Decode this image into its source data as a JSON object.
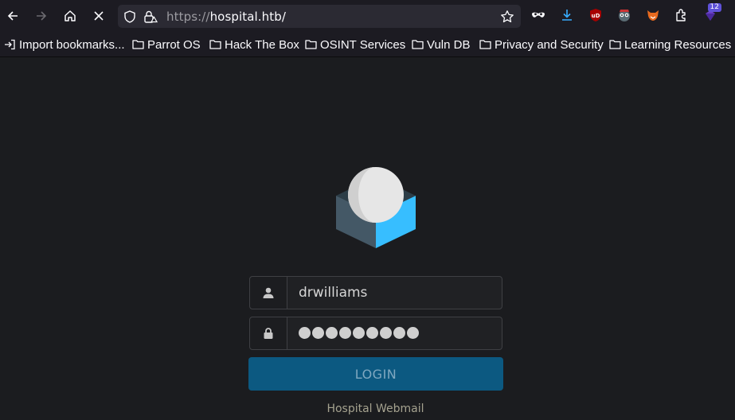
{
  "browser": {
    "url_scheme": "https://",
    "url_host": "hospital.htb/",
    "extension_badge": "12"
  },
  "bookmarks": [
    {
      "label": "Import bookmarks..."
    },
    {
      "label": "Parrot OS"
    },
    {
      "label": "Hack The Box"
    },
    {
      "label": "OSINT Services"
    },
    {
      "label": "Vuln DB"
    },
    {
      "label": "Privacy and Security"
    },
    {
      "label": "Learning Resources"
    }
  ],
  "login": {
    "username_value": "drwilliams",
    "password_length": 9,
    "submit_label": "LOGIN",
    "footer_text": "Hospital Webmail"
  },
  "colors": {
    "page_bg": "#1b1c1f",
    "toolbar_bg": "#1c1b22",
    "button_bg": "#0c5981",
    "logo_blue": "#37beff",
    "logo_dark": "#445866"
  }
}
